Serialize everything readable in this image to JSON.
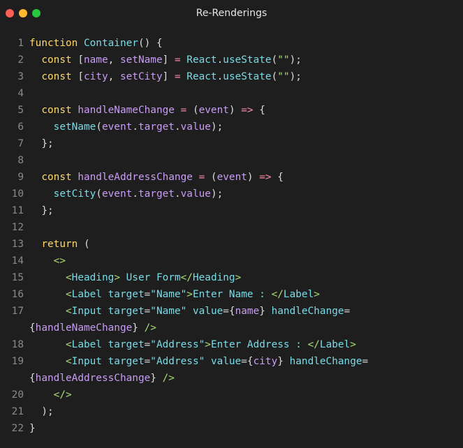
{
  "window": {
    "title": "Re-Renderings",
    "controls": [
      {
        "name": "close",
        "color": "#ff5f57"
      },
      {
        "name": "minimize",
        "color": "#febc2e"
      },
      {
        "name": "maximize",
        "color": "#28c840"
      }
    ]
  },
  "code": {
    "lines": [
      {
        "n": "1",
        "segs": [
          [
            "k",
            "function "
          ],
          [
            "f",
            "Container"
          ],
          [
            "p",
            "() {"
          ]
        ]
      },
      {
        "n": "2",
        "segs": [
          [
            "p",
            "  "
          ],
          [
            "k",
            "const "
          ],
          [
            "p",
            "["
          ],
          [
            "v",
            "name"
          ],
          [
            "p",
            ", "
          ],
          [
            "v",
            "setName"
          ],
          [
            "p",
            "] "
          ],
          [
            "o",
            "= "
          ],
          [
            "f",
            "React"
          ],
          [
            "p",
            "."
          ],
          [
            "f",
            "useState"
          ],
          [
            "p",
            "("
          ],
          [
            "s",
            "\"\""
          ],
          [
            "p",
            ");"
          ]
        ]
      },
      {
        "n": "3",
        "segs": [
          [
            "p",
            "  "
          ],
          [
            "k",
            "const "
          ],
          [
            "p",
            "["
          ],
          [
            "v",
            "city"
          ],
          [
            "p",
            ", "
          ],
          [
            "v",
            "setCity"
          ],
          [
            "p",
            "] "
          ],
          [
            "o",
            "= "
          ],
          [
            "f",
            "React"
          ],
          [
            "p",
            "."
          ],
          [
            "f",
            "useState"
          ],
          [
            "p",
            "("
          ],
          [
            "s",
            "\"\""
          ],
          [
            "p",
            ");"
          ]
        ]
      },
      {
        "n": "4",
        "segs": []
      },
      {
        "n": "5",
        "segs": [
          [
            "p",
            "  "
          ],
          [
            "k",
            "const "
          ],
          [
            "v",
            "handleNameChange "
          ],
          [
            "o",
            "= "
          ],
          [
            "p",
            "("
          ],
          [
            "v",
            "event"
          ],
          [
            "p",
            ") "
          ],
          [
            "o",
            "=> "
          ],
          [
            "p",
            "{"
          ]
        ]
      },
      {
        "n": "6",
        "segs": [
          [
            "p",
            "    "
          ],
          [
            "f",
            "setName"
          ],
          [
            "p",
            "("
          ],
          [
            "v",
            "event"
          ],
          [
            "p",
            "."
          ],
          [
            "v",
            "target"
          ],
          [
            "p",
            "."
          ],
          [
            "v",
            "value"
          ],
          [
            "p",
            ");"
          ]
        ]
      },
      {
        "n": "7",
        "segs": [
          [
            "p",
            "  };"
          ]
        ]
      },
      {
        "n": "8",
        "segs": []
      },
      {
        "n": "9",
        "segs": [
          [
            "p",
            "  "
          ],
          [
            "k",
            "const "
          ],
          [
            "v",
            "handleAddressChange "
          ],
          [
            "o",
            "= "
          ],
          [
            "p",
            "("
          ],
          [
            "v",
            "event"
          ],
          [
            "p",
            ") "
          ],
          [
            "o",
            "=> "
          ],
          [
            "p",
            "{"
          ]
        ]
      },
      {
        "n": "10",
        "segs": [
          [
            "p",
            "    "
          ],
          [
            "f",
            "setCity"
          ],
          [
            "p",
            "("
          ],
          [
            "v",
            "event"
          ],
          [
            "p",
            "."
          ],
          [
            "v",
            "target"
          ],
          [
            "p",
            "."
          ],
          [
            "v",
            "value"
          ],
          [
            "p",
            ");"
          ]
        ]
      },
      {
        "n": "11",
        "segs": [
          [
            "p",
            "  };"
          ]
        ]
      },
      {
        "n": "12",
        "segs": []
      },
      {
        "n": "13",
        "segs": [
          [
            "p",
            "  "
          ],
          [
            "k",
            "return "
          ],
          [
            "p",
            "("
          ]
        ]
      },
      {
        "n": "14",
        "segs": [
          [
            "p",
            "    "
          ],
          [
            "t",
            "<>"
          ]
        ]
      },
      {
        "n": "15",
        "segs": [
          [
            "p",
            "      "
          ],
          [
            "t",
            "<"
          ],
          [
            "f",
            "Heading"
          ],
          [
            "t",
            "> "
          ],
          [
            "f",
            "User Form"
          ],
          [
            "t",
            "</"
          ],
          [
            "f",
            "Heading"
          ],
          [
            "t",
            ">"
          ]
        ]
      },
      {
        "n": "16",
        "segs": [
          [
            "p",
            "      "
          ],
          [
            "t",
            "<"
          ],
          [
            "f",
            "Label "
          ],
          [
            "f",
            "target"
          ],
          [
            "p",
            "="
          ],
          [
            "f",
            "\"Name\""
          ],
          [
            "t",
            ">"
          ],
          [
            "f",
            "Enter Name : "
          ],
          [
            "t",
            "</"
          ],
          [
            "f",
            "Label"
          ],
          [
            "t",
            ">"
          ]
        ]
      },
      {
        "n": "17",
        "segs": [
          [
            "p",
            "      "
          ],
          [
            "t",
            "<"
          ],
          [
            "f",
            "Input "
          ],
          [
            "f",
            "target"
          ],
          [
            "p",
            "="
          ],
          [
            "f",
            "\"Name\" "
          ],
          [
            "f",
            "value"
          ],
          [
            "p",
            "={"
          ],
          [
            "v",
            "name"
          ],
          [
            "p",
            "} "
          ],
          [
            "f",
            "handleChange"
          ],
          [
            "p",
            "="
          ]
        ]
      },
      {
        "n": "",
        "wrap": true,
        "segs": [
          [
            "p",
            "{"
          ],
          [
            "v",
            "handleNameChange"
          ],
          [
            "p",
            "} "
          ],
          [
            "t",
            "/>"
          ]
        ]
      },
      {
        "n": "18",
        "segs": [
          [
            "p",
            "      "
          ],
          [
            "t",
            "<"
          ],
          [
            "f",
            "Label "
          ],
          [
            "f",
            "target"
          ],
          [
            "p",
            "="
          ],
          [
            "f",
            "\"Address\""
          ],
          [
            "t",
            ">"
          ],
          [
            "f",
            "Enter Address : "
          ],
          [
            "t",
            "</"
          ],
          [
            "f",
            "Label"
          ],
          [
            "t",
            ">"
          ]
        ]
      },
      {
        "n": "19",
        "segs": [
          [
            "p",
            "      "
          ],
          [
            "t",
            "<"
          ],
          [
            "f",
            "Input "
          ],
          [
            "f",
            "target"
          ],
          [
            "p",
            "="
          ],
          [
            "f",
            "\"Address\" "
          ],
          [
            "f",
            "value"
          ],
          [
            "p",
            "={"
          ],
          [
            "v",
            "city"
          ],
          [
            "p",
            "} "
          ],
          [
            "f",
            "handleChange"
          ],
          [
            "p",
            "="
          ]
        ]
      },
      {
        "n": "",
        "wrap": true,
        "segs": [
          [
            "p",
            "{"
          ],
          [
            "v",
            "handleAddressChange"
          ],
          [
            "p",
            "} "
          ],
          [
            "t",
            "/>"
          ]
        ]
      },
      {
        "n": "20",
        "segs": [
          [
            "p",
            "    "
          ],
          [
            "t",
            "</>"
          ]
        ]
      },
      {
        "n": "21",
        "segs": [
          [
            "p",
            "  );"
          ]
        ]
      },
      {
        "n": "22",
        "segs": [
          [
            "p",
            "}"
          ]
        ]
      }
    ]
  }
}
